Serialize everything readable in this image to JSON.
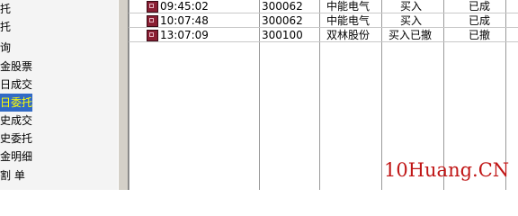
{
  "sidebar": {
    "items": [
      {
        "label": "托"
      },
      {
        "label": "托"
      },
      {
        "label": "询"
      },
      {
        "label": "金股票"
      },
      {
        "label": "日成交"
      },
      {
        "label": "日委托",
        "selected": true
      },
      {
        "label": "史成交"
      },
      {
        "label": "史委托"
      },
      {
        "label": "金明细"
      },
      {
        "label": "割  单"
      }
    ]
  },
  "orders": {
    "rows": [
      {
        "time": "09:45:02",
        "code": "300062",
        "name": "中能电气",
        "action": "买入",
        "status": "已成"
      },
      {
        "time": "10:07:48",
        "code": "300062",
        "name": "中能电气",
        "action": "买入",
        "status": "已成"
      },
      {
        "time": "13:07:09",
        "code": "300100",
        "name": "双林股份",
        "action": "买入已撤",
        "status": "已撤"
      }
    ]
  },
  "watermark": {
    "text": "10Huang.CN"
  },
  "colors": {
    "selection_bg": "#316ac5",
    "selection_text": "#ffff00",
    "watermark": "#c01616",
    "row_icon": "#8a1f33"
  }
}
